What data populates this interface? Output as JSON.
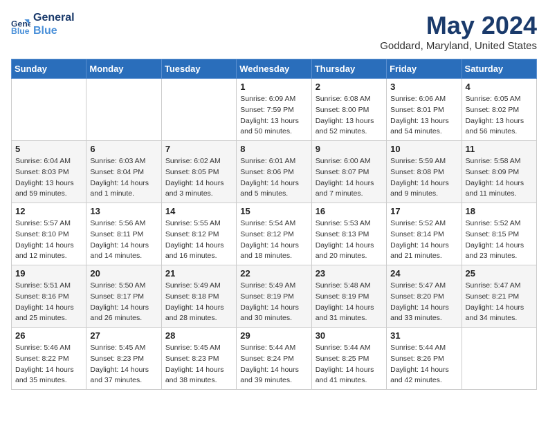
{
  "header": {
    "logo_line1": "General",
    "logo_line2": "Blue",
    "title": "May 2024",
    "subtitle": "Goddard, Maryland, United States"
  },
  "days_of_week": [
    "Sunday",
    "Monday",
    "Tuesday",
    "Wednesday",
    "Thursday",
    "Friday",
    "Saturday"
  ],
  "weeks": [
    [
      null,
      null,
      null,
      {
        "day": 1,
        "sunrise": "6:09 AM",
        "sunset": "7:59 PM",
        "daylight": "13 hours and 50 minutes."
      },
      {
        "day": 2,
        "sunrise": "6:08 AM",
        "sunset": "8:00 PM",
        "daylight": "13 hours and 52 minutes."
      },
      {
        "day": 3,
        "sunrise": "6:06 AM",
        "sunset": "8:01 PM",
        "daylight": "13 hours and 54 minutes."
      },
      {
        "day": 4,
        "sunrise": "6:05 AM",
        "sunset": "8:02 PM",
        "daylight": "13 hours and 56 minutes."
      }
    ],
    [
      {
        "day": 5,
        "sunrise": "6:04 AM",
        "sunset": "8:03 PM",
        "daylight": "13 hours and 59 minutes."
      },
      {
        "day": 6,
        "sunrise": "6:03 AM",
        "sunset": "8:04 PM",
        "daylight": "14 hours and 1 minute."
      },
      {
        "day": 7,
        "sunrise": "6:02 AM",
        "sunset": "8:05 PM",
        "daylight": "14 hours and 3 minutes."
      },
      {
        "day": 8,
        "sunrise": "6:01 AM",
        "sunset": "8:06 PM",
        "daylight": "14 hours and 5 minutes."
      },
      {
        "day": 9,
        "sunrise": "6:00 AM",
        "sunset": "8:07 PM",
        "daylight": "14 hours and 7 minutes."
      },
      {
        "day": 10,
        "sunrise": "5:59 AM",
        "sunset": "8:08 PM",
        "daylight": "14 hours and 9 minutes."
      },
      {
        "day": 11,
        "sunrise": "5:58 AM",
        "sunset": "8:09 PM",
        "daylight": "14 hours and 11 minutes."
      }
    ],
    [
      {
        "day": 12,
        "sunrise": "5:57 AM",
        "sunset": "8:10 PM",
        "daylight": "14 hours and 12 minutes."
      },
      {
        "day": 13,
        "sunrise": "5:56 AM",
        "sunset": "8:11 PM",
        "daylight": "14 hours and 14 minutes."
      },
      {
        "day": 14,
        "sunrise": "5:55 AM",
        "sunset": "8:12 PM",
        "daylight": "14 hours and 16 minutes."
      },
      {
        "day": 15,
        "sunrise": "5:54 AM",
        "sunset": "8:12 PM",
        "daylight": "14 hours and 18 minutes."
      },
      {
        "day": 16,
        "sunrise": "5:53 AM",
        "sunset": "8:13 PM",
        "daylight": "14 hours and 20 minutes."
      },
      {
        "day": 17,
        "sunrise": "5:52 AM",
        "sunset": "8:14 PM",
        "daylight": "14 hours and 21 minutes."
      },
      {
        "day": 18,
        "sunrise": "5:52 AM",
        "sunset": "8:15 PM",
        "daylight": "14 hours and 23 minutes."
      }
    ],
    [
      {
        "day": 19,
        "sunrise": "5:51 AM",
        "sunset": "8:16 PM",
        "daylight": "14 hours and 25 minutes."
      },
      {
        "day": 20,
        "sunrise": "5:50 AM",
        "sunset": "8:17 PM",
        "daylight": "14 hours and 26 minutes."
      },
      {
        "day": 21,
        "sunrise": "5:49 AM",
        "sunset": "8:18 PM",
        "daylight": "14 hours and 28 minutes."
      },
      {
        "day": 22,
        "sunrise": "5:49 AM",
        "sunset": "8:19 PM",
        "daylight": "14 hours and 30 minutes."
      },
      {
        "day": 23,
        "sunrise": "5:48 AM",
        "sunset": "8:19 PM",
        "daylight": "14 hours and 31 minutes."
      },
      {
        "day": 24,
        "sunrise": "5:47 AM",
        "sunset": "8:20 PM",
        "daylight": "14 hours and 33 minutes."
      },
      {
        "day": 25,
        "sunrise": "5:47 AM",
        "sunset": "8:21 PM",
        "daylight": "14 hours and 34 minutes."
      }
    ],
    [
      {
        "day": 26,
        "sunrise": "5:46 AM",
        "sunset": "8:22 PM",
        "daylight": "14 hours and 35 minutes."
      },
      {
        "day": 27,
        "sunrise": "5:45 AM",
        "sunset": "8:23 PM",
        "daylight": "14 hours and 37 minutes."
      },
      {
        "day": 28,
        "sunrise": "5:45 AM",
        "sunset": "8:23 PM",
        "daylight": "14 hours and 38 minutes."
      },
      {
        "day": 29,
        "sunrise": "5:44 AM",
        "sunset": "8:24 PM",
        "daylight": "14 hours and 39 minutes."
      },
      {
        "day": 30,
        "sunrise": "5:44 AM",
        "sunset": "8:25 PM",
        "daylight": "14 hours and 41 minutes."
      },
      {
        "day": 31,
        "sunrise": "5:44 AM",
        "sunset": "8:26 PM",
        "daylight": "14 hours and 42 minutes."
      },
      null
    ]
  ],
  "labels": {
    "sunrise": "Sunrise:",
    "sunset": "Sunset:",
    "daylight": "Daylight:"
  }
}
